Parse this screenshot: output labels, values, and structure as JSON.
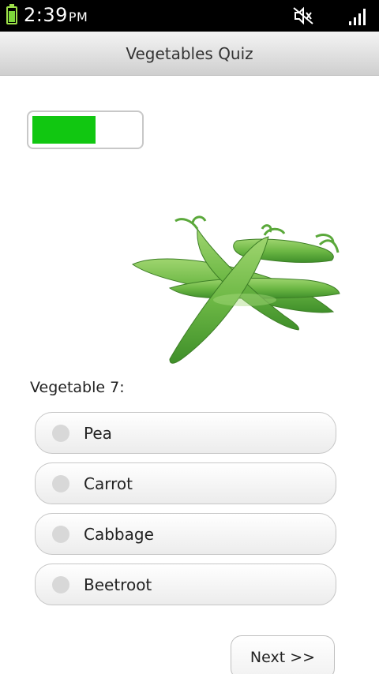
{
  "status_bar": {
    "time": "2:39",
    "ampm": "PM",
    "battery_level": 0.75,
    "icons": [
      "battery-icon",
      "mute-icon",
      "signal-icon"
    ]
  },
  "title": "Vegetables Quiz",
  "progress": {
    "fraction": 0.6
  },
  "image": {
    "subject": "snow peas",
    "icon": "pea-pod-image"
  },
  "question": "Vegetable 7:",
  "options": [
    {
      "label": "Pea"
    },
    {
      "label": "Carrot"
    },
    {
      "label": "Cabbage"
    },
    {
      "label": "Beetroot"
    }
  ],
  "next_label": "Next >>",
  "colors": {
    "progress_fill": "#11c711",
    "battery": "#7dd93a",
    "title_bar_top": "#f4f4f4",
    "title_bar_bottom": "#cfcfcf"
  }
}
